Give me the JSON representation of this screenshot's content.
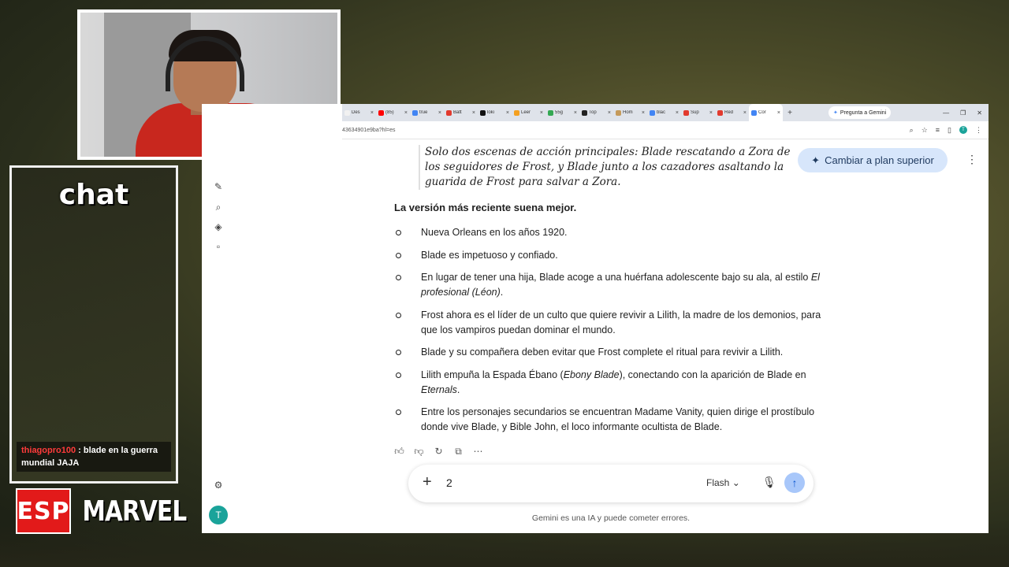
{
  "stream": {
    "chat": {
      "title": "chat",
      "message_user": "thiagopro100",
      "message_sep": " : ",
      "message_text": "blade en la guerra mundial JAJA"
    },
    "logo": {
      "left": "ESP",
      "right": "MARVEL"
    }
  },
  "browser": {
    "tabs": [
      {
        "label": "Des",
        "color": "#f1f1f1"
      },
      {
        "label": "(85)",
        "color": "#ff0000"
      },
      {
        "label": "true",
        "color": "#4285f4"
      },
      {
        "label": "Batt",
        "color": "#e23a2e"
      },
      {
        "label": "loki",
        "color": "#111111"
      },
      {
        "label": "Leer",
        "color": "#f4a021"
      },
      {
        "label": "55g",
        "color": "#34a853"
      },
      {
        "label": "Top",
        "color": "#222222"
      },
      {
        "label": "Hom",
        "color": "#c59a5b"
      },
      {
        "label": "blac",
        "color": "#4285f4"
      },
      {
        "label": "Sup",
        "color": "#e23a2e"
      },
      {
        "label": "Red",
        "color": "#e23a2e"
      },
      {
        "label": "Cor",
        "color": "#4285f4",
        "active": true
      }
    ],
    "gemini_button": "Pregunta a Gemini",
    "url": "43634901e9ba?hl=es"
  },
  "gemini": {
    "quote": "Solo dos escenas de acción principales: Blade rescatando a Zora de los seguidores de Frost, y Blade junto a los cazadores asaltando la guarida de Frost para salvar a Zora.",
    "upgrade_label": "Cambiar a plan superior",
    "heading": "La versión más reciente suena mejor.",
    "items": [
      {
        "text": "Nueva Orleans en los años 1920."
      },
      {
        "text": "Blade es impetuoso y confiado."
      },
      {
        "text": "En lugar de tener una hija, Blade acoge a una huérfana adolescente bajo su ala, al estilo ",
        "em": "El profesional (Léon)",
        "after": "."
      },
      {
        "text": "Frost ahora es el líder de un culto que quiere revivir a Lilith, la madre de los demonios, para que los vampiros puedan dominar el mundo."
      },
      {
        "text": "Blade y su compañera deben evitar que Frost complete el ritual para revivir a Lilith."
      },
      {
        "text": "Lilith empuña la Espada Ébano (",
        "em": "Ebony Blade",
        "after": "), conectando con la aparición de Blade en ",
        "em2": "Eternals",
        "after2": "."
      },
      {
        "text": "Entre los personajes secundarios se encuentran Madame Vanity, quien dirige el prostíbulo donde vive Blade, y Bible John, el loco informante ocultista de Blade."
      }
    ],
    "input_value": "2",
    "model_label": "Flash",
    "disclaimer": "Gemini es una IA y puede cometer errores.",
    "avatar_letter": "T"
  }
}
